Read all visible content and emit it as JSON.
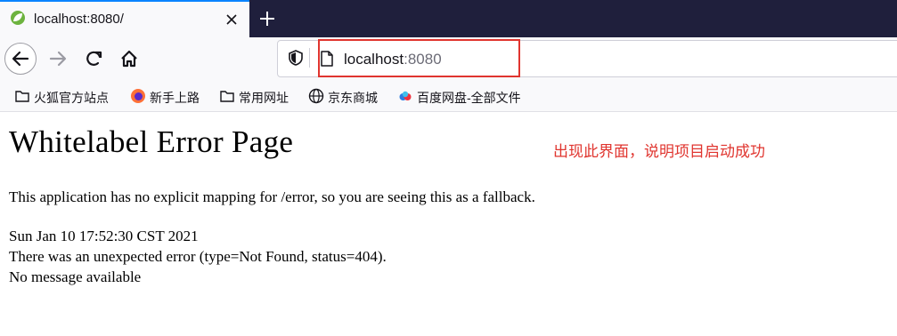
{
  "browser": {
    "tab": {
      "title": "localhost:8080/"
    },
    "urlbar": {
      "host": "localhost",
      "port": ":8080"
    },
    "bookmarks": [
      "火狐官方站点",
      "新手上路",
      "常用网址",
      "京东商城",
      "百度网盘-全部文件"
    ]
  },
  "page": {
    "title": "Whitelabel Error Page",
    "message": "This application has no explicit mapping for /error, so you are seeing this as a fallback.",
    "timestamp": "Sun Jan 10 17:52:30 CST 2021",
    "error_line": "There was an unexpected error (type=Not Found, status=404).",
    "detail": "No message available"
  },
  "annotation": "出现此界面，说明项目启动成功",
  "colors": {
    "highlight": "#e0352f",
    "tab_accent": "#0a84ff",
    "tabstrip": "#1f1f3c"
  }
}
